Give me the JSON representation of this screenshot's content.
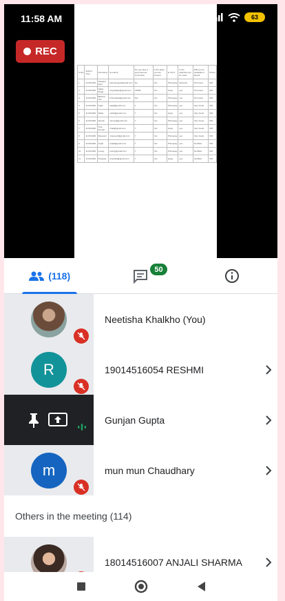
{
  "status_bar": {
    "time": "11:58 AM",
    "battery": "63"
  },
  "recording": {
    "label": "REC"
  },
  "shared_document": {
    "header": [
      "S.NO",
      "Submit Time",
      "Full Name",
      "E-mail Id",
      "Do you have a good internet connection",
      "Is the place you are present",
      "E.Y.E.S",
      "Is the attached can be used",
      "Will you be available to attend",
      "Phone"
    ],
    "rows": [
      [
        "1",
        "11.08.2020",
        "Sangeet Kaur",
        "kaursangeet@gmail.com",
        "No",
        "Yes",
        "Phonepay",
        "Discount",
        "Not Good",
        "520"
      ],
      [
        "2",
        "11.08.2020",
        "Saket Singh",
        "singhsaket@gmail.com",
        "UNOB",
        "Yes",
        "Gpay",
        "yes",
        "Not Good",
        "520"
      ],
      [
        "3",
        "11.08.2020",
        "Bhavna Jha",
        "bhavnajha@gmail.com",
        "Not",
        "Yes",
        "Phonepay",
        "yes",
        "Not Good",
        "520"
      ],
      [
        "4",
        "11.08.2020",
        "Kajal",
        "kajal@gmail.com",
        "Y",
        "Yes",
        "Phonepay",
        "yes",
        "Very Good",
        "520"
      ],
      [
        "5",
        "11.08.2020",
        "Nikita",
        "nikita@gmail.com",
        "Y",
        "Yes",
        "Gpay",
        "yes",
        "Very Good",
        "520"
      ],
      [
        "6",
        "11.08.2020",
        "Simran",
        "simran@gmail.com",
        "Y",
        "Yes",
        "Phonepay",
        "yes",
        "Very Good",
        "520"
      ],
      [
        "7",
        "11.08.2020",
        "Tina Kumari",
        "tinak@gmail.com",
        "Y",
        "Yes",
        "Gpay",
        "yes",
        "Very Good",
        "520"
      ],
      [
        "8",
        "11.08.2020",
        "Mausumi",
        "mausumi@gmail.com",
        "Y",
        "Yes",
        "Phonepay",
        "yes",
        "Very Good",
        "520"
      ],
      [
        "9",
        "11.08.2020",
        "Anjali",
        "anjali@gmail.com",
        "Y",
        "Yes",
        "Phonepay",
        "yes",
        "Not Bad",
        "520"
      ],
      [
        "10",
        "11.08.2020",
        "Lovely",
        "lovely@gmail.com",
        "Y",
        "Yes",
        "Phonepay",
        "yes",
        "Not Bad",
        "520"
      ],
      [
        "11",
        "11.08.2020",
        "Priyanka",
        "priyanka@gmail.com",
        "Y",
        "Yes",
        "Gpay",
        "yes",
        "Not Bad",
        "520"
      ]
    ]
  },
  "tabs": {
    "people_count": "(118)",
    "chat_badge": "50"
  },
  "participants": [
    {
      "name": "Neetisha Khalkho (You)",
      "avatar_type": "photo",
      "muted": true
    },
    {
      "name": "19014516054 RESHMI",
      "avatar_letter": "R",
      "avatar_color": "#12939a",
      "muted": true
    },
    {
      "name": "Gunjan Gupta",
      "presenting": true
    },
    {
      "name": "mun mun Chaudhary",
      "avatar_letter": "m",
      "avatar_color": "#1565c0",
      "muted": true
    }
  ],
  "others_section": {
    "title": "Others in the meeting (114)"
  },
  "others": [
    {
      "name": "18014516007 ANJALI SHARMA",
      "avatar_type": "photo"
    }
  ],
  "colors": {
    "accent": "#1a73e8",
    "mute": "#d93025",
    "rec": "#c62828",
    "badge": "#188038"
  },
  "icons": [
    "people-icon",
    "chat-icon",
    "info-icon",
    "mic-off-icon",
    "pin-icon",
    "present-icon",
    "audio-level-icon",
    "chevron-right-icon"
  ]
}
